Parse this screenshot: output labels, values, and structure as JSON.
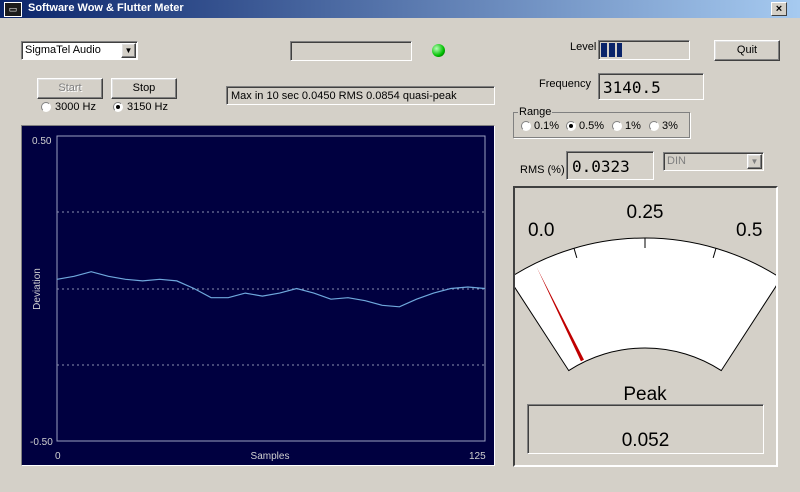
{
  "window": {
    "title": "Software Wow & Flutter Meter",
    "close_label": "×",
    "icon": "app-window-icon"
  },
  "device_select": {
    "value": "SigmaTel Audio",
    "arrow": "▼"
  },
  "level": {
    "label": "Level",
    "fraction": 0.1
  },
  "quit_label": "Quit",
  "controls": {
    "start_label": "Start",
    "stop_label": "Stop",
    "start_enabled": false
  },
  "ref_freq": {
    "options": [
      "3000 Hz",
      "3150 Hz"
    ],
    "selected": 1
  },
  "status_text": "Max in 10 sec 0.0450 RMS 0.0854 quasi-peak",
  "indicator": {
    "color": "#00c000"
  },
  "frequency": {
    "label": "Frequency",
    "value": "3140.5"
  },
  "range": {
    "label": "Range",
    "options": [
      "0.1%",
      "0.5%",
      "1%",
      "3%"
    ],
    "selected": 1
  },
  "rms": {
    "label": "RMS (%)",
    "value": "0.0323"
  },
  "weighting_select": {
    "value": "DIN",
    "arrow": "▼",
    "enabled": false
  },
  "plot": {
    "y_top": "0.50",
    "y_bottom": "-0.50",
    "x_left": "0",
    "x_right": "125",
    "xlabel": "Samples",
    "ylabel": "Deviation",
    "bg": "#000040",
    "line_color": "#6fa8dc"
  },
  "chart_data": {
    "type": "line",
    "xlabel": "Samples",
    "ylabel": "Deviation",
    "xlim": [
      0,
      125
    ],
    "ylim": [
      -0.5,
      0.5
    ],
    "grid": "dotted at ±0.25 and 0",
    "x": [
      0,
      5,
      10,
      15,
      20,
      25,
      30,
      35,
      40,
      45,
      50,
      55,
      60,
      65,
      70,
      75,
      80,
      85,
      90,
      95,
      100,
      105,
      110,
      115,
      120,
      125
    ],
    "y": [
      0.03,
      0.04,
      0.055,
      0.04,
      0.03,
      0.025,
      0.03,
      0.025,
      0.0,
      -0.03,
      -0.03,
      -0.015,
      -0.025,
      -0.015,
      0.0,
      -0.015,
      -0.035,
      -0.03,
      -0.04,
      -0.055,
      -0.06,
      -0.035,
      -0.015,
      0.0,
      0.005,
      0.0
    ]
  },
  "meter": {
    "scale_labels": [
      "0.0",
      "0.25",
      "0.5"
    ],
    "label": "Peak",
    "value": "0.052",
    "needle_value": 0.052,
    "max": 0.5,
    "needle_color": "#c00000"
  }
}
